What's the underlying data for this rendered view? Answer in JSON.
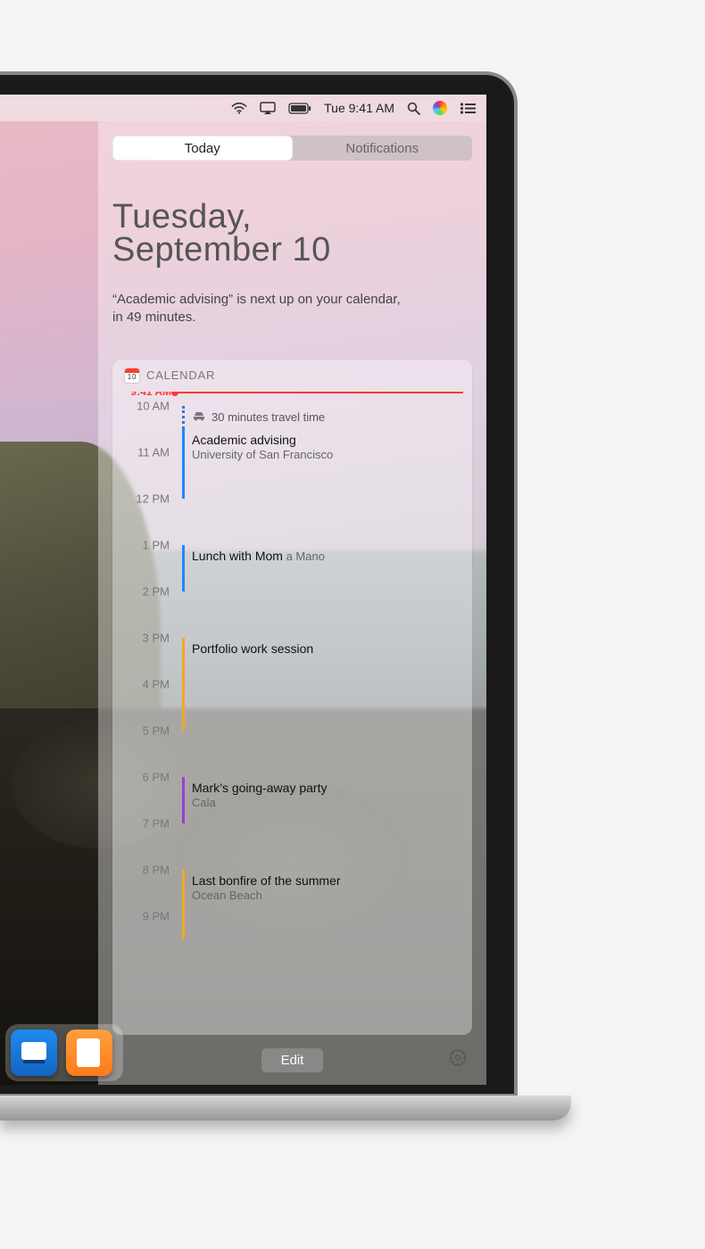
{
  "menubar": {
    "clock": "Tue 9:41 AM"
  },
  "nc": {
    "tabs": {
      "today": "Today",
      "notifications": "Notifications",
      "activeIndex": 0
    },
    "date": {
      "weekday": "Tuesday,",
      "monthday": "September 10"
    },
    "suggestion": "“Academic advising” is next up on your calendar, in 49 minutes.",
    "calendar": {
      "header": "CALENDAR",
      "iconDay": "10",
      "now": {
        "label": "9:41 AM",
        "hour": 9.683
      },
      "startHour": 9.683,
      "endHour": 21.5,
      "pxPerHour": 52,
      "hourLabels": [
        {
          "h": 10,
          "text": "10 AM"
        },
        {
          "h": 11,
          "text": "11 AM"
        },
        {
          "h": 12,
          "text": "12 PM"
        },
        {
          "h": 13,
          "text": "1 PM"
        },
        {
          "h": 14,
          "text": "2 PM"
        },
        {
          "h": 15,
          "text": "3 PM"
        },
        {
          "h": 16,
          "text": "4 PM"
        },
        {
          "h": 17,
          "text": "5 PM"
        },
        {
          "h": 18,
          "text": "6 PM"
        },
        {
          "h": 19,
          "text": "7 PM"
        },
        {
          "h": 20,
          "text": "8 PM"
        },
        {
          "h": 21,
          "text": "9 PM"
        }
      ],
      "travel": {
        "start": 10.0,
        "end": 10.5,
        "text": "30 minutes travel time"
      },
      "events": [
        {
          "start": 10.5,
          "end": 12.0,
          "color": "#1e88ff",
          "title": "Academic advising",
          "sub": "University of San Francisco",
          "inline": false
        },
        {
          "start": 13.0,
          "end": 14.0,
          "color": "#1e88ff",
          "title": "Lunch with Mom",
          "sub": "a Mano",
          "inline": true
        },
        {
          "start": 15.0,
          "end": 17.0,
          "color": "#f5a623",
          "title": "Portfolio work session",
          "sub": "",
          "inline": false
        },
        {
          "start": 18.0,
          "end": 19.0,
          "color": "#9b3fd1",
          "title": "Mark’s going-away party",
          "sub": "Cala",
          "inline": false
        },
        {
          "start": 20.0,
          "end": 21.5,
          "color": "#f5a623",
          "title": "Last bonfire of the summer",
          "sub": "Ocean Beach",
          "inline": false
        }
      ]
    },
    "footer": {
      "edit": "Edit"
    }
  },
  "dock": {
    "apps": [
      "Keynote",
      "Pages"
    ]
  }
}
